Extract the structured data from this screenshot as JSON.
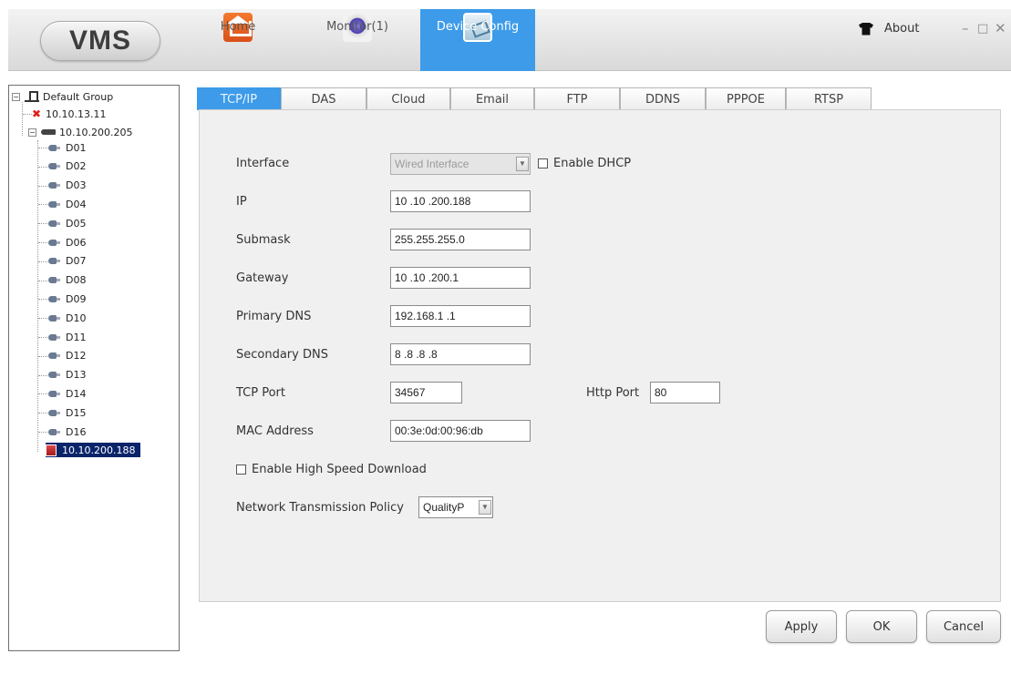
{
  "app": {
    "logo": "VMS"
  },
  "nav": {
    "home": "Home",
    "monitor": "Monitor(1)",
    "device_config": "Device Config",
    "about": "About"
  },
  "window_controls": {
    "minimize": "–",
    "maximize": "□",
    "close": "✕"
  },
  "tree": {
    "group": "Default Group",
    "device_offline": "10.10.13.11",
    "device_dvr": "10.10.200.205",
    "channels": [
      "D01",
      "D02",
      "D03",
      "D04",
      "D05",
      "D06",
      "D07",
      "D08",
      "D09",
      "D10",
      "D11",
      "D12",
      "D13",
      "D14",
      "D15",
      "D16"
    ],
    "device_selected": "10.10.200.188",
    "expander_collapse": "−"
  },
  "tabs": [
    "TCP/IP",
    "DAS",
    "Cloud",
    "Email",
    "FTP",
    "DDNS",
    "PPPOE",
    "RTSP"
  ],
  "active_tab": "TCP/IP",
  "form": {
    "interface_label": "Interface",
    "interface_value": "Wired Interface",
    "enable_dhcp": "Enable DHCP",
    "ip_label": "IP",
    "ip_value": "10 .10 .200.188",
    "submask_label": "Submask",
    "submask_value": "255.255.255.0",
    "gateway_label": "Gateway",
    "gateway_value": "10 .10 .200.1",
    "primary_dns_label": "Primary DNS",
    "primary_dns_value": "192.168.1 .1",
    "secondary_dns_label": "Secondary DNS",
    "secondary_dns_value": "8 .8 .8 .8",
    "tcp_port_label": "TCP Port",
    "tcp_port_value": "34567",
    "http_port_label": "Http Port",
    "http_port_value": "80",
    "mac_label": "MAC Address",
    "mac_value": "00:3e:0d:00:96:db",
    "high_speed": "Enable High Speed Download",
    "policy_label": "Network Transmission Policy",
    "policy_value": "QualityP"
  },
  "buttons": {
    "apply": "Apply",
    "ok": "OK",
    "cancel": "Cancel"
  },
  "colors": {
    "accent": "#3d9be9",
    "selection": "#0a246a",
    "offline_icon": "#e0201a"
  }
}
